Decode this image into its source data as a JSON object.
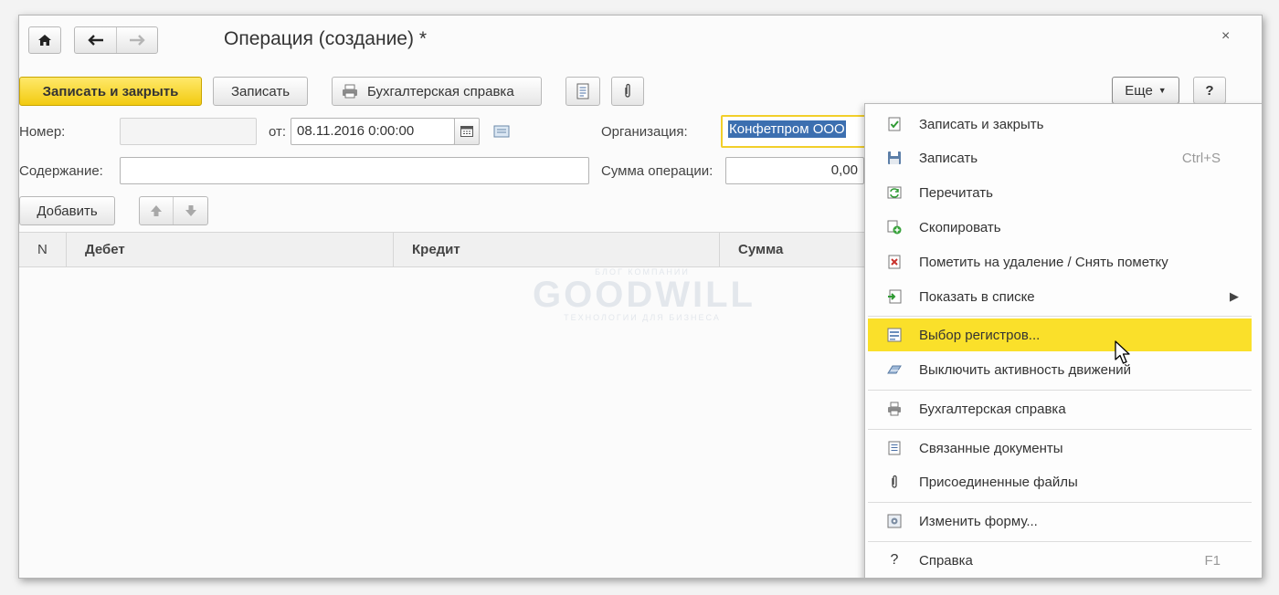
{
  "window": {
    "title": "Операция (создание) *",
    "close_glyph": "×"
  },
  "nav": {
    "home_icon": "home-icon",
    "back_icon": "arrow-left-icon",
    "forward_icon": "arrow-right-icon"
  },
  "toolbar": {
    "save_close_label": "Записать и закрыть",
    "save_label": "Записать",
    "report_label": "Бухгалтерская справка",
    "more_label": "Еще",
    "help_label": "?"
  },
  "form": {
    "number_label": "Номер:",
    "number_value": "",
    "date_label": "от:",
    "date_value": "08.11.2016  0:00:00",
    "organization_label": "Организация:",
    "organization_value": "Конфетпром ООО",
    "content_label": "Содержание:",
    "content_value": "",
    "sum_label": "Сумма операции:",
    "sum_value": "0,00"
  },
  "table": {
    "add_label": "Добавить",
    "columns": [
      "N",
      "Дебет",
      "Кредит",
      "Сумма"
    ]
  },
  "watermark": {
    "top": "БЛОГ КОМПАНИИ",
    "main": "GOODWILL",
    "bottom": "ТЕХНОЛОГИИ ДЛЯ БИЗНЕСА"
  },
  "menu": {
    "items": [
      {
        "label": "Записать и закрыть",
        "icon": "save-close-icon",
        "shortcut": ""
      },
      {
        "label": "Записать",
        "icon": "floppy-disk-icon",
        "shortcut": "Ctrl+S"
      },
      {
        "label": "Перечитать",
        "icon": "reread-icon",
        "shortcut": ""
      },
      {
        "label": "Скопировать",
        "icon": "copy-icon",
        "shortcut": ""
      },
      {
        "label": "Пометить на удаление / Снять пометку",
        "icon": "delete-mark-icon",
        "shortcut": ""
      },
      {
        "label": "Показать в списке",
        "icon": "show-in-list-icon",
        "shortcut": ""
      },
      {
        "label": "Выбор регистров...",
        "icon": "registers-icon",
        "shortcut": ""
      },
      {
        "label": "Выключить активность движений",
        "icon": "disable-movements-icon",
        "shortcut": ""
      },
      {
        "label": "Бухгалтерская справка",
        "icon": "printer-icon",
        "shortcut": ""
      },
      {
        "label": "Связанные документы",
        "icon": "related-docs-icon",
        "shortcut": ""
      },
      {
        "label": "Присоединенные файлы",
        "icon": "paperclip-icon",
        "shortcut": ""
      },
      {
        "label": "Изменить форму...",
        "icon": "form-settings-icon",
        "shortcut": ""
      },
      {
        "label": "Справка",
        "icon": "question-icon",
        "shortcut": "F1"
      }
    ],
    "highlight_color": "#fae02a"
  },
  "colors": {
    "primary_button": "#f5d31c",
    "menu_highlight": "#fae02a",
    "organization_focus": "#f2cf2a",
    "selection": "#3c6fb0"
  }
}
